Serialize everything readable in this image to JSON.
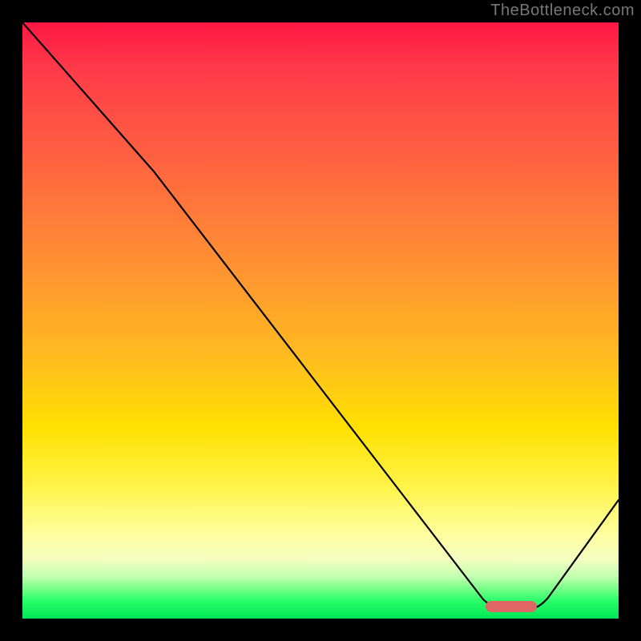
{
  "watermark": "TheBottleneck.com",
  "chart_data": {
    "type": "line",
    "title": "",
    "xlabel": "",
    "ylabel": "",
    "xlim": [
      0,
      100
    ],
    "ylim": [
      0,
      100
    ],
    "grid": false,
    "legend": false,
    "series": [
      {
        "name": "curve",
        "x": [
          0,
          22,
          79,
          85,
          100
        ],
        "values": [
          100,
          75,
          0,
          0,
          20
        ]
      }
    ],
    "marker": {
      "name": "target-range",
      "x_start": 79,
      "x_end": 87,
      "y": 1.5,
      "color": "#e06666"
    },
    "colors": {
      "gradient_top": "#ff1744",
      "gradient_mid": "#ffe000",
      "gradient_bottom": "#00e656",
      "curve": "#000000",
      "marker": "#e06666",
      "frame": "#000000"
    }
  }
}
